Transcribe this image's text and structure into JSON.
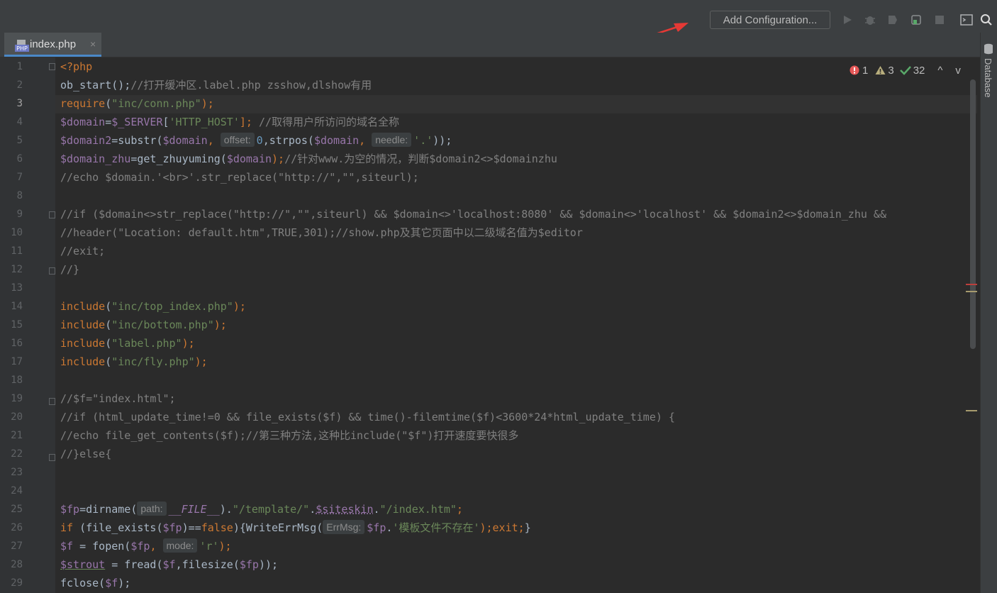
{
  "toolbar": {
    "add_configuration_label": "Add Configuration...",
    "icons": [
      "run-icon",
      "debug-icon",
      "coverage-icon",
      "profile-icon",
      "stop-icon",
      "terminal-icon",
      "search-icon"
    ]
  },
  "tabs": [
    {
      "label": "index.php",
      "file_type_badge": "PHP",
      "close_symbol": "×"
    }
  ],
  "inspections": {
    "errors": "1",
    "warnings": "3",
    "typos": "32",
    "up_symbol": "^",
    "down_symbol": "v"
  },
  "sidebar": {
    "database_label": "Database"
  },
  "current_line": "3",
  "line_numbers": [
    "1",
    "2",
    "3",
    "4",
    "5",
    "6",
    "7",
    "8",
    "9",
    "10",
    "11",
    "12",
    "13",
    "14",
    "15",
    "16",
    "17",
    "18",
    "19",
    "20",
    "21",
    "22",
    "23",
    "24",
    "25",
    "26",
    "27",
    "28",
    "29"
  ],
  "code_text": {
    "l1": "<?php",
    "l2a": "ob_start();",
    "l2b": "//打开缓冲区.label.php zsshow,dlshow有用",
    "l3a": "require",
    "l3b": "(",
    "l3c": "\"inc/conn.php\"",
    "l3d": ");",
    "l4a": "$domain",
    "l4b": "=",
    "l4c": "$_SERVER",
    "l4d": "[",
    "l4e": "'HTTP_HOST'",
    "l4f": "];",
    "l4g": " //取得用户所访问的域名全称",
    "l5a": "$domain2",
    "l5b": "=substr(",
    "l5c": "$domain",
    "l5d": ",",
    "l5hint1": "offset:",
    "l5e": "0",
    "l5f": ",strpos(",
    "l5g": "$domain",
    "l5h": ",",
    "l5hint2": "needle:",
    "l5i": "'.'",
    "l5j": "));",
    "l6a": "$domain_zhu",
    "l6b": "=get_zhuyuming(",
    "l6c": "$domain",
    "l6d": ");",
    "l6e": "//针对www.为空的情况，判断$domain2<>$domainzhu",
    "l7": "//echo $domain.'<br>'.str_replace(\"http://\",\"\",siteurl);",
    "l9": "//if ($domain<>str_replace(\"http://\",\"\",siteurl) && $domain<>'localhost:8080' && $domain<>'localhost' && $domain2<>$domain_zhu &&",
    "l10": "//header(\"Location: default.htm\",TRUE,301);//show.php及其它页面中以二级域名值为$editor",
    "l11": "//exit;",
    "l12": "//}",
    "l14a": "include",
    "l14b": "(",
    "l14c": "\"inc/top_index.php\"",
    "l14d": ");",
    "l15c": "\"inc/bottom.php\"",
    "l16c": "\"label.php\"",
    "l17c": "\"inc/fly.php\"",
    "l19": "//$f=\"index.html\";",
    "l20": "//if (html_update_time!=0 && file_exists($f) && time()-filemtime($f)<3600*24*html_update_time) {",
    "l21": "//echo file_get_contents($f);//第三种方法,这种比include(\"$f\")打开速度要快很多",
    "l22": "//}else{",
    "l25a": "$fp",
    "l25b": "=dirname(",
    "l25hint": "path:",
    "l25c": "__FILE__",
    "l25d": ").",
    "l25e": "\"/template/\"",
    "l25f": ".",
    "l25g": "$siteskin",
    "l25h": ".",
    "l25i": "\"/index.htm\"",
    "l25j": ";",
    "l26a": "if",
    "l26b": " (file_exists(",
    "l26c": "$fp",
    "l26d": ")==",
    "l26e": "false",
    "l26f": "){WriteErrMsg(",
    "l26hint": "ErrMsg:",
    "l26g": "$fp",
    "l26h": ".",
    "l26i": "'模板文件不存在'",
    "l26j": ");",
    "l26k": "exit;",
    "l26l": "}",
    "l27a": "$f",
    "l27b": " = fopen(",
    "l27c": "$fp",
    "l27d": ",",
    "l27hint": "mode:",
    "l27e": "'r'",
    "l27f": ");",
    "l28a": "$strout",
    "l28b": " = fread(",
    "l28c": "$f",
    "l28d": ",filesize(",
    "l28e": "$fp",
    "l28f": "));",
    "l29a": "fclose(",
    "l29b": "$f",
    "l29c": ");"
  },
  "colors": {
    "annotation_arrow": "#e53935",
    "accent": "#4a88c7",
    "keyword": "#cc7832",
    "string": "#6a8759",
    "variable": "#9876aa"
  }
}
